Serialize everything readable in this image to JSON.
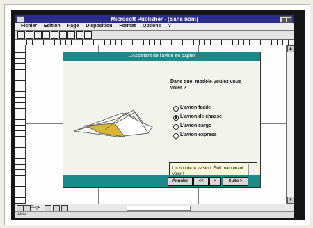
{
  "window": {
    "title": "Microsoft Publisher - [Sans nom]"
  },
  "menubar": {
    "items": [
      "Fichier",
      "Edition",
      "Page",
      "Disposition",
      "Format",
      "Options",
      "?"
    ]
  },
  "dialog": {
    "title": "L'Assistant de l'avion en papier",
    "question": "Dans quel modèle voulez vous voler ?",
    "options": [
      "L'avion facile",
      "L'avion de chasse",
      "L'avion cargo",
      "L'avion express"
    ],
    "selected_option": 1,
    "info_text": "Un bon de la version, Éloïf maintenant voler !",
    "buttons": [
      "Annuler",
      "<<",
      "<",
      "Suite >"
    ]
  },
  "bottom": {
    "page_label": "Page",
    "status_text": "Aide"
  },
  "colors": {
    "titlebar": "#2c2c8a",
    "dialog_teal": "#1b8b8a",
    "monitor_frame": "#151515",
    "dialog_fill": "#f3f3ee",
    "info_fill": "#fff9d8"
  }
}
